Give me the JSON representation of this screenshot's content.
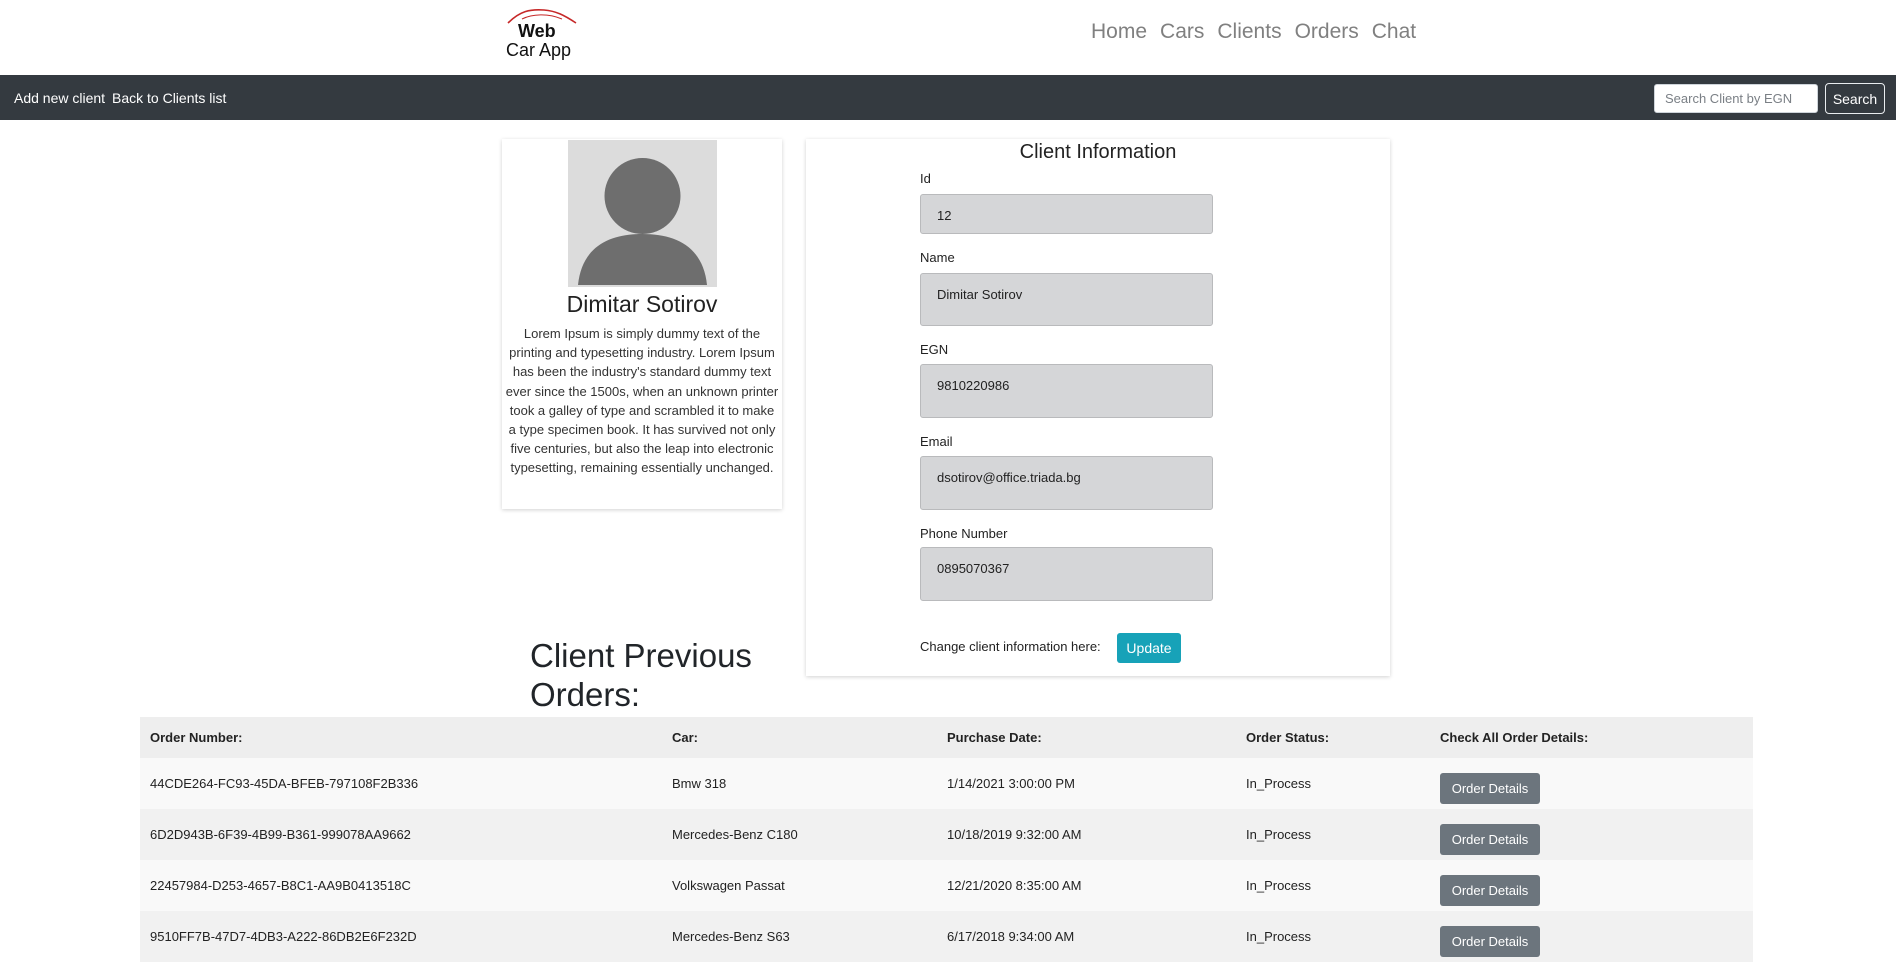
{
  "brand": {
    "line1": "Web",
    "line2": "Car App"
  },
  "nav": {
    "items": [
      "Home",
      "Cars",
      "Clients",
      "Orders",
      "Chat"
    ]
  },
  "toolbar": {
    "add_client": "Add new client",
    "back_to_list": "Back to Clients list",
    "search_placeholder": "Search Client by EGN",
    "search_button": "Search"
  },
  "profile": {
    "name": "Dimitar Sotirov",
    "bio": "Lorem Ipsum is simply dummy text of the printing and typesetting industry. Lorem Ipsum has been the industry's standard dummy text ever since the 1500s, when an unknown printer took a galley of type and scrambled it to make a type specimen book. It has survived not only five centuries, but also the leap into electronic typesetting, remaining essentially unchanged."
  },
  "client_info": {
    "title": "Client Information",
    "fields": [
      {
        "label": "Id",
        "value": "12"
      },
      {
        "label": "Name",
        "value": "Dimitar Sotirov"
      },
      {
        "label": "EGN",
        "value": "9810220986"
      },
      {
        "label": "Email",
        "value": "dsotirov@office.triada.bg"
      },
      {
        "label": "Phone Number",
        "value": "0895070367"
      }
    ],
    "change_label": "Change client information here:",
    "update_button": "Update"
  },
  "orders": {
    "title": "Client Previous Orders:",
    "columns": [
      "Order Number:",
      "Car:",
      "Purchase Date:",
      "Order Status:",
      "Check All Order Details:"
    ],
    "rows": [
      {
        "number": "44CDE264-FC93-45DA-BFEB-797108F2B336",
        "car": "Bmw 318",
        "date": "1/14/2021 3:00:00 PM",
        "status": "In_Process",
        "button": "Order Details"
      },
      {
        "number": "6D2D943B-6F39-4B99-B361-999078AA9662",
        "car": "Mercedes-Benz C180",
        "date": "10/18/2019 9:32:00 AM",
        "status": "In_Process",
        "button": "Order Details"
      },
      {
        "number": "22457984-D253-4657-B8C1-AA9B0413518C",
        "car": "Volkswagen Passat",
        "date": "12/21/2020 8:35:00 AM",
        "status": "In_Process",
        "button": "Order Details"
      },
      {
        "number": "9510FF7B-47D7-4DB3-A222-86DB2E6F232D",
        "car": "Mercedes-Benz S63",
        "date": "6/17/2018 9:34:00 AM",
        "status": "In_Process",
        "button": "Order Details"
      }
    ]
  },
  "colors": {
    "navbar_dark": "#343a40",
    "update_button": "#17a2b8",
    "detail_button": "#6c757d",
    "logo_roof": "#c62828"
  }
}
